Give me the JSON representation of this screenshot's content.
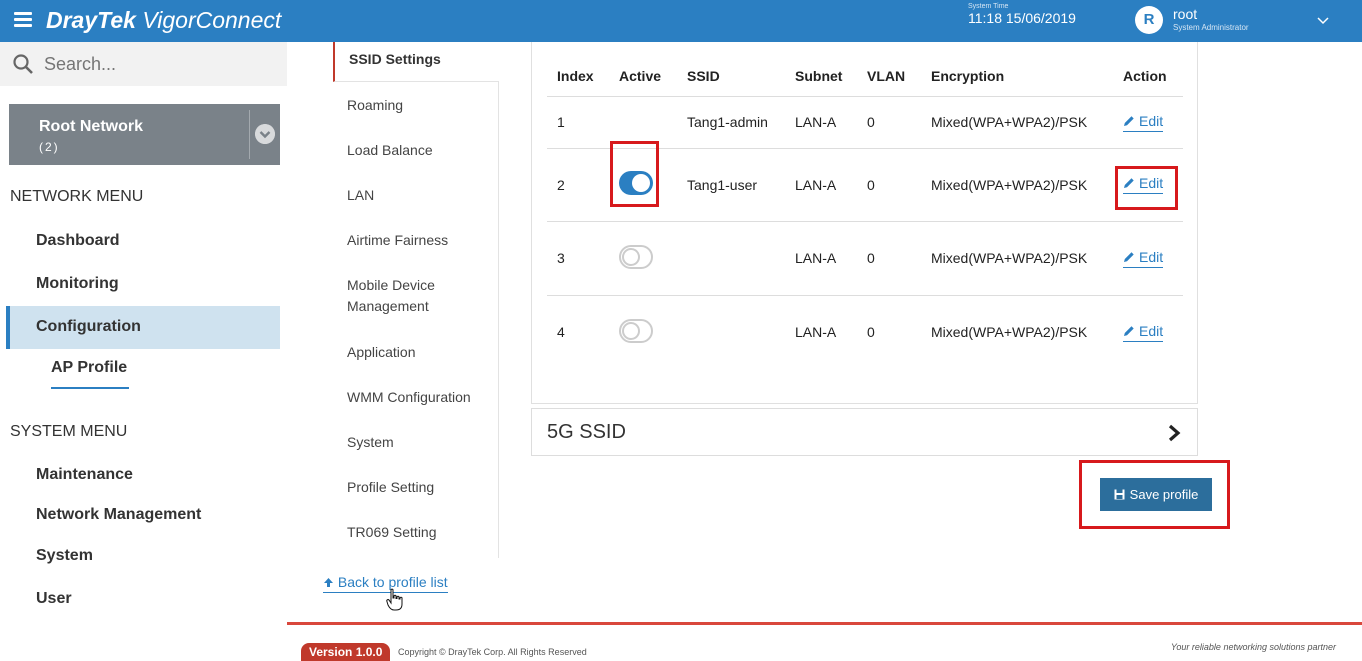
{
  "header": {
    "brand_bold": "DrayTek",
    "brand_rest": " VigorConnect",
    "system_time_label": "System Time",
    "system_time": "11:18 15/06/2019",
    "avatar_letter": "R",
    "user_name": "root",
    "user_role": "System Administrator"
  },
  "search": {
    "placeholder": "Search..."
  },
  "network": {
    "name": "Root Network",
    "count": "(2)"
  },
  "sidebar": {
    "network_menu": "NETWORK MENU",
    "dashboard": "Dashboard",
    "monitoring": "Monitoring",
    "configuration": "Configuration",
    "ap_profile": "AP Profile",
    "system_menu": "SYSTEM MENU",
    "maintenance": "Maintenance",
    "network_management": "Network Management",
    "system": "System",
    "user": "User"
  },
  "profile_nav": {
    "items": [
      "SSID Settings",
      "Roaming",
      "Load Balance",
      "LAN",
      "Airtime Fairness",
      "Mobile Device Management",
      "Application",
      "WMM Configuration",
      "System",
      "Profile Setting",
      "TR069 Setting"
    ],
    "back": "Back to profile list"
  },
  "table": {
    "headers": [
      "Index",
      "Active",
      "SSID",
      "Subnet",
      "VLAN",
      "Encryption",
      "Action"
    ],
    "rows": [
      {
        "index": "1",
        "active": null,
        "ssid": "Tang1-admin",
        "subnet": "LAN-A",
        "vlan": "0",
        "encryption": "Mixed(WPA+WPA2)/PSK",
        "action": "Edit"
      },
      {
        "index": "2",
        "active": true,
        "ssid": "Tang1-user",
        "subnet": "LAN-A",
        "vlan": "0",
        "encryption": "Mixed(WPA+WPA2)/PSK",
        "action": "Edit"
      },
      {
        "index": "3",
        "active": false,
        "ssid": "",
        "subnet": "LAN-A",
        "vlan": "0",
        "encryption": "Mixed(WPA+WPA2)/PSK",
        "action": "Edit"
      },
      {
        "index": "4",
        "active": false,
        "ssid": "",
        "subnet": "LAN-A",
        "vlan": "0",
        "encryption": "Mixed(WPA+WPA2)/PSK",
        "action": "Edit"
      }
    ]
  },
  "ssid_5g": {
    "label": "5G SSID"
  },
  "save": {
    "label": "Save profile"
  },
  "footer": {
    "version": "Version 1.0.0",
    "copyright": "Copyright © DrayTek Corp. All Rights Reserved",
    "tagline": "Your reliable networking solutions partner"
  },
  "colors": {
    "header_bg": "#2b7fc2",
    "accent": "#2b7fc2",
    "highlight_red": "#d7191c",
    "save_btn": "#2c6e9c"
  }
}
